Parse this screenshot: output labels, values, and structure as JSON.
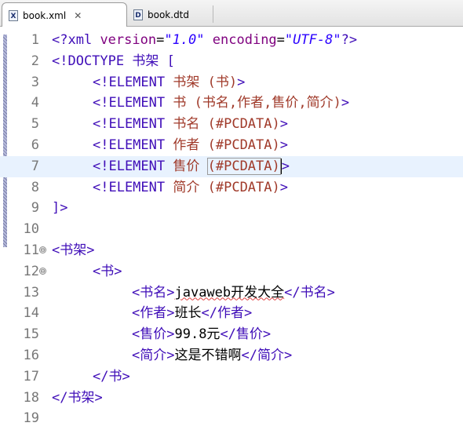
{
  "tabs": [
    {
      "label": "book.xml",
      "icon": "X",
      "active": true,
      "close": "✕"
    },
    {
      "label": "book.dtd",
      "icon": "D",
      "active": false
    }
  ],
  "editor": {
    "lines": [
      {
        "n": "1"
      },
      {
        "n": "2"
      },
      {
        "n": "3"
      },
      {
        "n": "4"
      },
      {
        "n": "5"
      },
      {
        "n": "6"
      },
      {
        "n": "7"
      },
      {
        "n": "8"
      },
      {
        "n": "9"
      },
      {
        "n": "10"
      },
      {
        "n": "11"
      },
      {
        "n": "12"
      },
      {
        "n": "13"
      },
      {
        "n": "14"
      },
      {
        "n": "15"
      },
      {
        "n": "16"
      },
      {
        "n": "17"
      },
      {
        "n": "18"
      },
      {
        "n": "19"
      }
    ],
    "decl": {
      "open": "<?xml",
      "ver_attr": "version",
      "ver_val": "\"1.0\"",
      "enc_attr": "encoding",
      "enc_val": "\"UTF-8\"",
      "close": "?>"
    },
    "doctype": {
      "kw": "<!DOCTYPE",
      "name": "书架",
      "open": "["
    },
    "elements": [
      {
        "kw": "<!ELEMENT",
        "name": "书架",
        "model": "(书)",
        "end": ">"
      },
      {
        "kw": "<!ELEMENT",
        "name": "书",
        "model": "(书名,作者,售价,简介)",
        "end": ">"
      },
      {
        "kw": "<!ELEMENT",
        "name": "书名",
        "model": "(#PCDATA)",
        "end": ">"
      },
      {
        "kw": "<!ELEMENT",
        "name": "作者",
        "model": "(#PCDATA)",
        "end": ">"
      },
      {
        "kw": "<!ELEMENT",
        "name": "售价",
        "model": "(#PCDATA)",
        "end": ">"
      },
      {
        "kw": "<!ELEMENT",
        "name": "简介",
        "model": "(#PCDATA)",
        "end": ">"
      }
    ],
    "doctype_close": "]>",
    "xml": {
      "root_open": "<书架>",
      "book_open": "<书>",
      "title": {
        "open": "<书名>",
        "text": "javaweb开发大全",
        "close": "</书名>"
      },
      "author": {
        "open": "<作者>",
        "text": "班长",
        "close": "</作者>"
      },
      "price": {
        "open": "<售价>",
        "text": "99.8元",
        "close": "</售价>"
      },
      "intro": {
        "open": "<简介>",
        "text": "这是不错啊",
        "close": "</简介>"
      },
      "book_close": "</书>",
      "root_close": "</书架>"
    },
    "fold_icon": "⊖"
  }
}
